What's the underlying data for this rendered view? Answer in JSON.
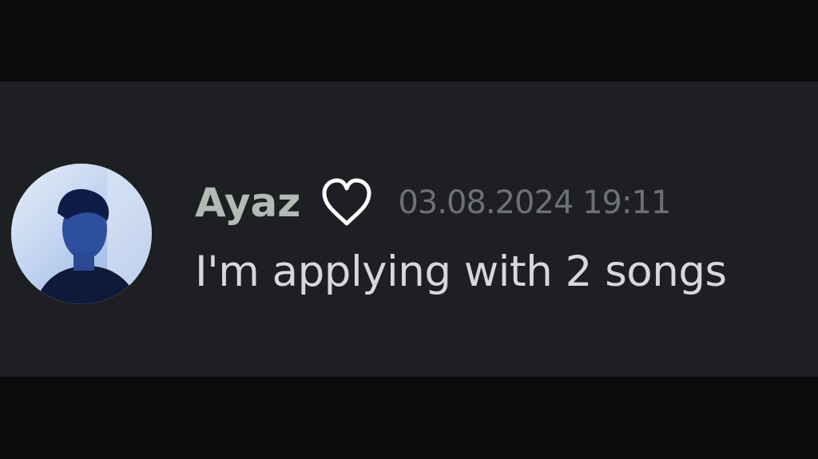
{
  "message": {
    "author": {
      "username": "Ayaz",
      "avatar_icon": "user-avatar-photo"
    },
    "badge_icon": "heart-outline-icon",
    "timestamp": "03.08.2024 19:11",
    "content": "I'm applying with 2 songs"
  },
  "colors": {
    "background": "#0b0b0c",
    "message_background": "#1e1f22",
    "username": "#b1bab3",
    "timestamp": "#6d7077",
    "content": "#d6d8da",
    "heart": "#ffffff"
  }
}
